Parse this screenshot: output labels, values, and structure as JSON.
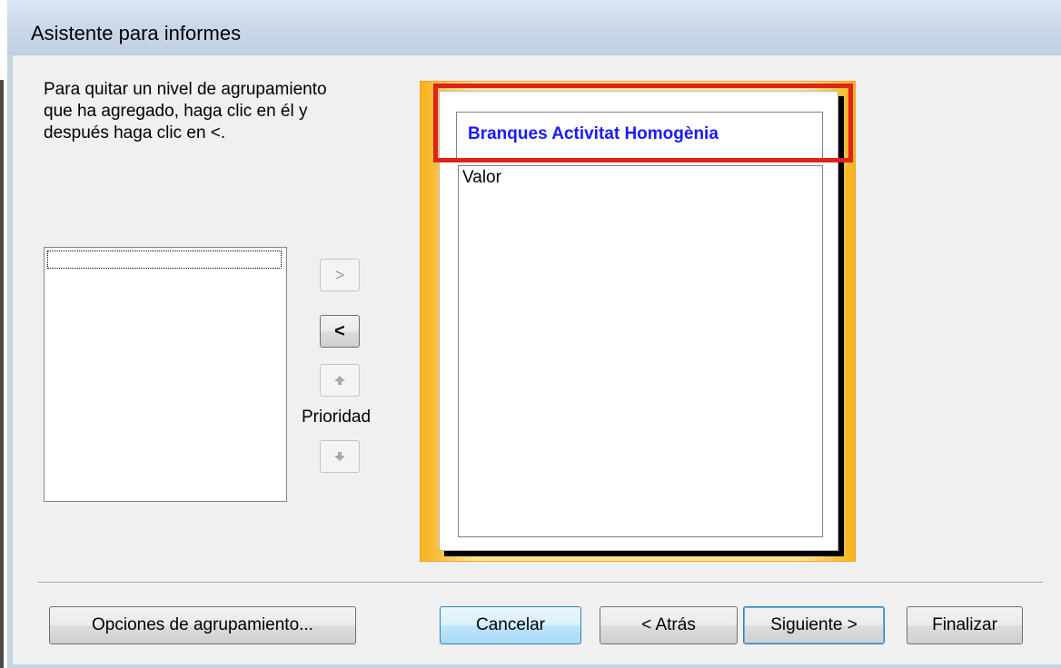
{
  "window": {
    "title": "Asistente para informes"
  },
  "instructions": "Para quitar un nivel de agrupamiento\nque ha agregado, haga clic en él y\ndespués haga clic en <.",
  "controls": {
    "add_label": ">",
    "remove_label": "<",
    "priority_label": "Prioridad"
  },
  "preview": {
    "group_header": "Branques Activitat Homogènia",
    "detail_field": "Valor"
  },
  "buttons": {
    "grouping_options": "Opciones de agrupamiento...",
    "cancel": "Cancelar",
    "back": "< Atrás",
    "next": "Siguiente >",
    "finish": "Finalizar"
  },
  "colors": {
    "highlight": "#e0221b",
    "group_header_text": "#1a1aff",
    "preview_background": "#fde38a"
  },
  "icons": {
    "priority_up": "arrow-up-icon",
    "priority_down": "arrow-down-icon"
  }
}
